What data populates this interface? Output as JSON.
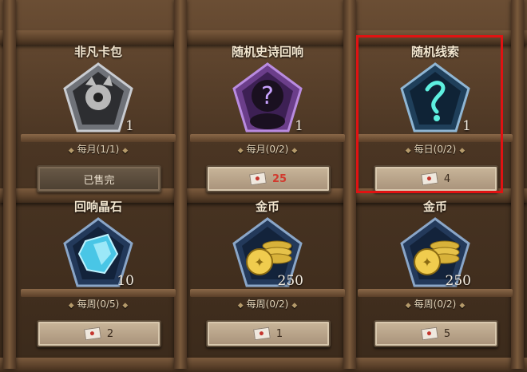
{
  "shop": {
    "items": [
      {
        "title": "非凡卡包",
        "count": "1",
        "limit": "每月(1/1)",
        "button": "已售完",
        "price": "",
        "sold_out": true,
        "icon": "card-pack-icon"
      },
      {
        "title": "随机史诗回响",
        "count": "1",
        "limit": "每月(0/2)",
        "button": "",
        "price": "25",
        "sold_out": false,
        "icon": "mystery-epic-echo-icon"
      },
      {
        "title": "随机线索",
        "count": "1",
        "limit": "每日(0/2)",
        "button": "",
        "price": "4",
        "sold_out": false,
        "icon": "clue-icon"
      },
      {
        "title": "回响晶石",
        "count": "10",
        "limit": "每周(0/5)",
        "button": "",
        "price": "2",
        "sold_out": false,
        "icon": "echo-crystal-icon"
      },
      {
        "title": "金币",
        "count": "250",
        "limit": "每周(0/2)",
        "button": "",
        "price": "1",
        "sold_out": false,
        "icon": "gold-coins-icon"
      },
      {
        "title": "金币",
        "count": "250",
        "limit": "每周(0/2)",
        "button": "",
        "price": "5",
        "sold_out": false,
        "icon": "gold-coins-icon"
      }
    ]
  },
  "colors": {
    "highlight": "#e01212",
    "price_red": "#d23a2e"
  }
}
